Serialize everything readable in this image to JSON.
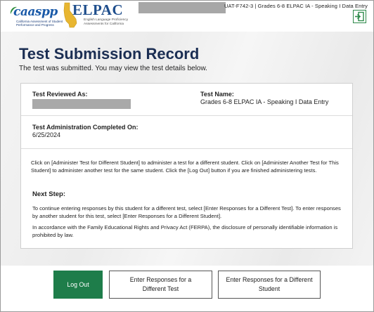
{
  "header": {
    "caaspp_logo_text": "caaspp",
    "caaspp_logo_subtitle": "California Assessment of Student Performance and Progress",
    "elpac_logo_text": "ELPAC",
    "elpac_logo_subtitle": "English Language Proficiency Assessments for California",
    "test_identifier": "UAT-F742-3 | Grades 6-8 ELPAC IA - Speaking I Data Entry",
    "exit_icon": "exit-door-icon"
  },
  "main": {
    "title": "Test Submission Record",
    "subtitle": "The test was submitted. You may view the test details below."
  },
  "card": {
    "test_reviewed_label": "Test Reviewed As:",
    "test_name_label": "Test Name:",
    "test_name_value": "Grades 6-8 ELPAC IA - Speaking I Data Entry",
    "admin_completed_label": "Test Administration Completed On:",
    "admin_completed_value": "6/25/2024",
    "instructions": "Click on [Administer Test for Different Student] to administer a test for a different student. Click on [Administer Another Test for This Student] to administer another test for the same student. Click the [Log Out] button if you are finished administering tests.",
    "next_step_heading": "Next Step:",
    "next_step_text": "To continue entering responses by this student for a different test, select [Enter Responses for a Different Test]. To enter responses by another student for this test, select [Enter Responses for a Different Student].",
    "ferpa_text": "In accordance with the Family Educational Rights and Privacy Act (FERPA), the disclosure of personally identifiable information is prohibited by law."
  },
  "footer": {
    "logout_label": "Log Out",
    "diff_test_label": "Enter Responses for a Different Test",
    "diff_student_label": "Enter Responses for a Different Student"
  },
  "colors": {
    "title": "#1b2e53",
    "logout_bg": "#1e7d4a",
    "accent_green": "#2e8a4a"
  }
}
